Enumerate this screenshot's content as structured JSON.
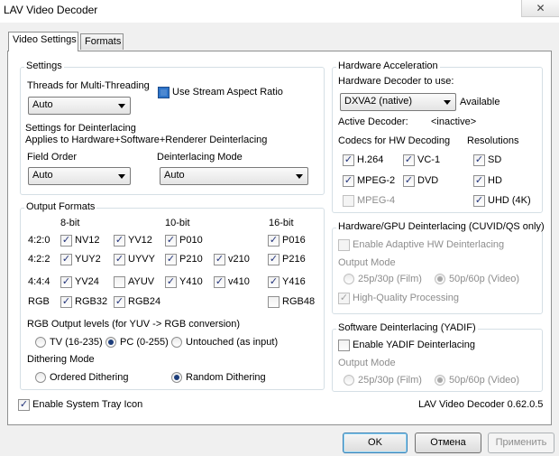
{
  "window": {
    "title": "LAV Video Decoder",
    "close_glyph": "✕"
  },
  "tabs": [
    "Video Settings",
    "Formats"
  ],
  "settings": {
    "title": "Settings",
    "threads_label": "Threads for Multi-Threading",
    "threads_value": "Auto",
    "stream_aspect_label": "Use Stream Aspect Ratio",
    "deint_title1": "Settings for Deinterlacing",
    "deint_title2": "Applies to Hardware+Software+Renderer Deinterlacing",
    "field_order_label": "Field Order",
    "field_order_value": "Auto",
    "deint_mode_label": "Deinterlacing Mode",
    "deint_mode_value": "Auto"
  },
  "output": {
    "title": "Output Formats",
    "col_8bit": "8-bit",
    "col_10bit": "10-bit",
    "col_16bit": "16-bit",
    "row_420": "4:2:0",
    "row_422": "4:2:2",
    "row_444": "4:4:4",
    "row_rgb": "RGB",
    "nv12": "NV12",
    "yv12": "YV12",
    "p010": "P010",
    "p016": "P016",
    "yuy2": "YUY2",
    "uyvy": "UYVY",
    "p210": "P210",
    "v210": "v210",
    "p216": "P216",
    "yv24": "YV24",
    "ayuv": "AYUV",
    "y410": "Y410",
    "v410": "v410",
    "y416": "Y416",
    "rgb32": "RGB32",
    "rgb24": "RGB24",
    "rgb48": "RGB48",
    "levels_label": "RGB Output levels (for YUV -> RGB conversion)",
    "tv": "TV (16-235)",
    "pc": "PC (0-255)",
    "untouched": "Untouched (as input)",
    "dither_label": "Dithering Mode",
    "ordered": "Ordered Dithering",
    "random": "Random Dithering"
  },
  "hw": {
    "title": "Hardware Acceleration",
    "decoder_label": "Hardware Decoder to use:",
    "decoder_value": "DXVA2 (native)",
    "available": "Available",
    "active_label": "Active Decoder:",
    "active_value": "<inactive>",
    "codecs_label": "Codecs for HW Decoding",
    "res_label": "Resolutions",
    "h264": "H.264",
    "vc1": "VC-1",
    "sd": "SD",
    "mpeg2": "MPEG-2",
    "dvd": "DVD",
    "hd": "HD",
    "mpeg4": "MPEG-4",
    "uhd": "UHD (4K)"
  },
  "hwdeint": {
    "title": "Hardware/GPU Deinterlacing (CUVID/QS only)",
    "adaptive": "Enable Adaptive HW Deinterlacing",
    "mode_label": "Output Mode",
    "film": "25p/30p (Film)",
    "video": "50p/60p (Video)",
    "hq": "High-Quality Processing"
  },
  "swdeint": {
    "title": "Software Deinterlacing (YADIF)",
    "enable": "Enable YADIF Deinterlacing",
    "mode_label": "Output Mode",
    "film": "25p/30p (Film)",
    "video": "50p/60p (Video)"
  },
  "footer": {
    "tray": "Enable System Tray Icon",
    "version": "LAV Video Decoder 0.62.0.5"
  },
  "buttons": {
    "ok": "OK",
    "cancel": "Отмена",
    "apply": "Применить"
  },
  "check_glyph": "✓"
}
